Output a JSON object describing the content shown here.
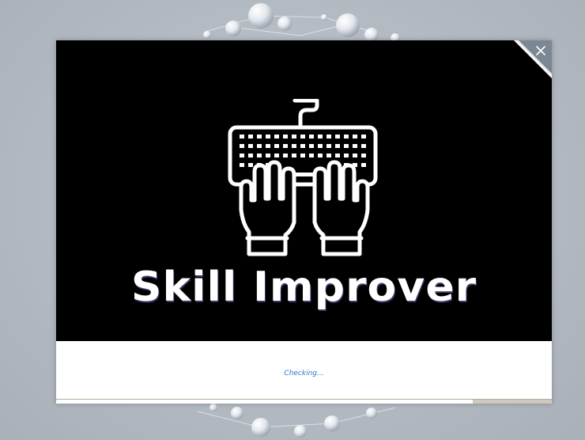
{
  "app": {
    "title": "Skill Improver",
    "logo_icon": "keyboard-typing-hands-icon"
  },
  "window": {
    "close_icon": "close-icon",
    "close_symbol": "×"
  },
  "status": {
    "text": "Checking..."
  },
  "progress": {
    "fraction": 0.84
  },
  "colors": {
    "banner_background": "#000000",
    "title_text": "#ffffff",
    "status_text": "#2e73c8",
    "progress_fill": "#ffffff",
    "progress_track": "#cfc9bd",
    "desktop_background": "#b8bfc7"
  }
}
